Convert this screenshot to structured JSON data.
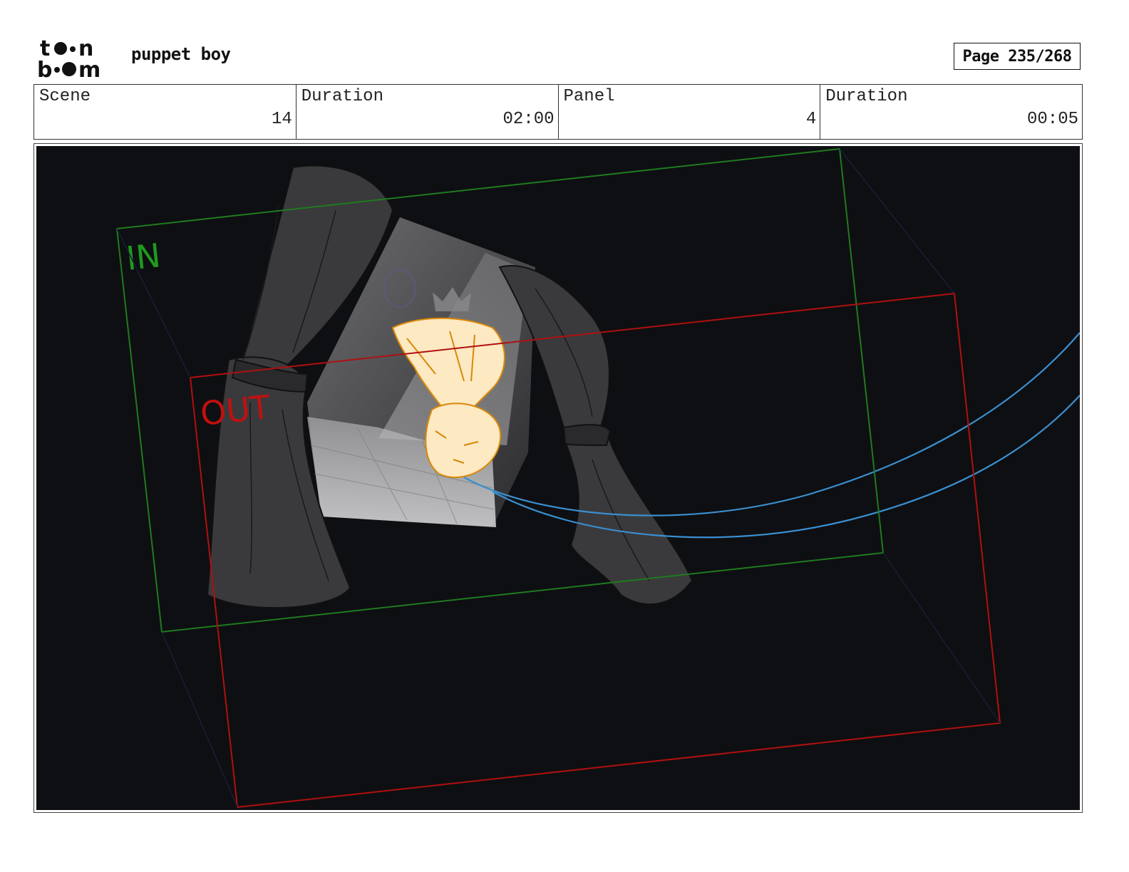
{
  "header": {
    "logo_text_top": "toon",
    "logo_text_bottom": "boom",
    "project_title": "puppet boy",
    "page_label": "Page 235/268"
  },
  "info": {
    "scene_label": "Scene",
    "scene_value": "14",
    "scene_duration_label": "Duration",
    "scene_duration_value": "02:00",
    "panel_label": "Panel",
    "panel_value": "4",
    "panel_duration_label": "Duration",
    "panel_duration_value": "00:05"
  },
  "panel": {
    "in_label": "IN",
    "out_label": "OUT",
    "colors": {
      "background": "#0e0f12",
      "in_frame": "#1f7a1f",
      "out_frame": "#b01010",
      "camera_path": "#3a8fd0",
      "character": "#fde9c2",
      "character_outline": "#d9880a",
      "curtain": "#3a3a3c"
    }
  }
}
